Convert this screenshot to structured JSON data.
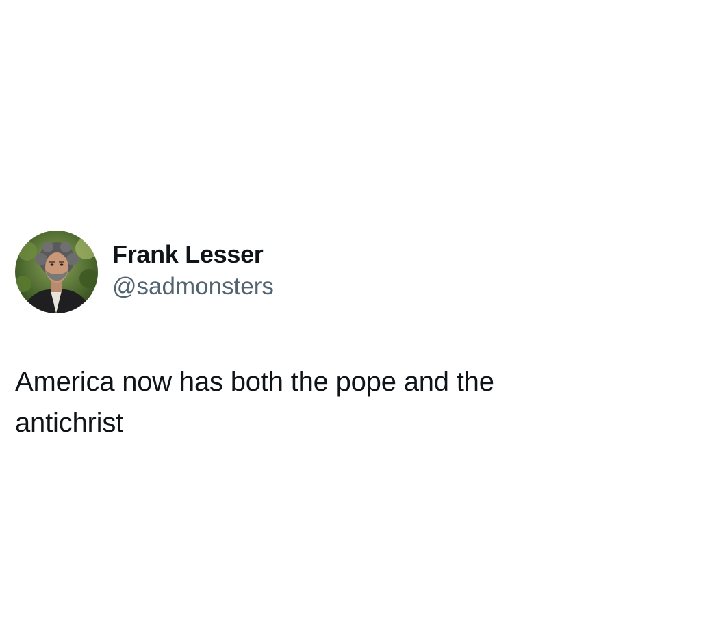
{
  "tweet": {
    "author": {
      "display_name": "Frank Lesser",
      "handle": "@sadmonsters",
      "avatar_icon": "profile-photo"
    },
    "text_line_1": "America now has both the pope and the",
    "text_line_2": "antichrist"
  },
  "colors": {
    "background": "#ffffff",
    "primary_text": "#0f1419",
    "secondary_text": "#536471"
  }
}
